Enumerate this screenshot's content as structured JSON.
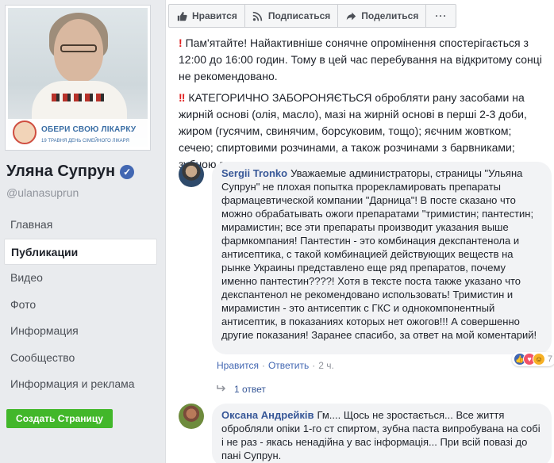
{
  "profile": {
    "banner_title": "ОБЕРИ СВОЮ ЛІКАРКУ",
    "banner_subtitle": "19 ТРАВНЯ ДЕНЬ СІМЕЙНОГО ЛІКАРЯ",
    "name": "Уляна Супрун",
    "handle": "@ulanasuprun"
  },
  "nav": {
    "items": [
      {
        "label": "Главная"
      },
      {
        "label": "Публикации"
      },
      {
        "label": "Видео"
      },
      {
        "label": "Фото"
      },
      {
        "label": "Информация"
      },
      {
        "label": "Сообщество"
      },
      {
        "label": "Информация и реклама"
      }
    ],
    "create_label": "Создать Страницу"
  },
  "actions": {
    "like": "Нравится",
    "subscribe": "Подписаться",
    "share": "Поделиться",
    "more": "···"
  },
  "post": {
    "para1": "Пам'ятайте! Найактивніше сонячне опромінення спостерігається з 12:00 до 16:00 годин. Тому в цей час перебування на відкритому сонці не рекомендовано.",
    "para2": "КАТЕГОРИЧНО ЗАБОРОНЯЄТЬСЯ обробляти рану засобами на жирній основі (олія, масло), мазі на жирній основі в перші 2-3 доби, жиром (гусячим, свинячим, борсуковим, тощо); яєчним жовтком; сечею; спиртовими розчинами, а також розчинами з барвниками; зубною пастою."
  },
  "comments": [
    {
      "author": "Sergii Tronko",
      "text": "Уважаемые администраторы, страницы \"Ульяна Супрун\" не плохая попытка прорекламировать препараты фармацевтической компании \"Дарница\"! В посте сказано что можно обрабатывать ожоги препаратами \"тримистин; пантестин; мирамистин; все эти препараты производит указания выше фармкомпания! Пантестин - это комбинация декспантенола и антисептика, с такой комбинацией действующих веществ на рынке Украины представлено еще ряд препаратов, почему именно пантестин????! Хотя в тексте поста также указано что декспантенол не рекомендовано использовать! Тримистин и мирамистин - это антисептик с ГКС и однокомпонентный антисептик, в показаниях которых нет ожогов!!! А совершенно другие показания! Заранее спасибо, за ответ на мой коментарий!",
      "like": "Нравится",
      "reply": "Ответить",
      "time": "2 ч.",
      "reaction_count": "7",
      "replies_label": "1 ответ"
    },
    {
      "author": "Оксана Андрейків",
      "text": "Гм.... Щось не зростається... Все життя обробляли опіки 1-го ст спиртом, зубна паста випробувана на собі і не раз - якась ненадійна у вас інформація... При всій повазі до пані Супрун."
    }
  ],
  "colors": {
    "link": "#385898",
    "green": "#42b72a",
    "verified": "#4267b2",
    "warning": "#e02020"
  }
}
